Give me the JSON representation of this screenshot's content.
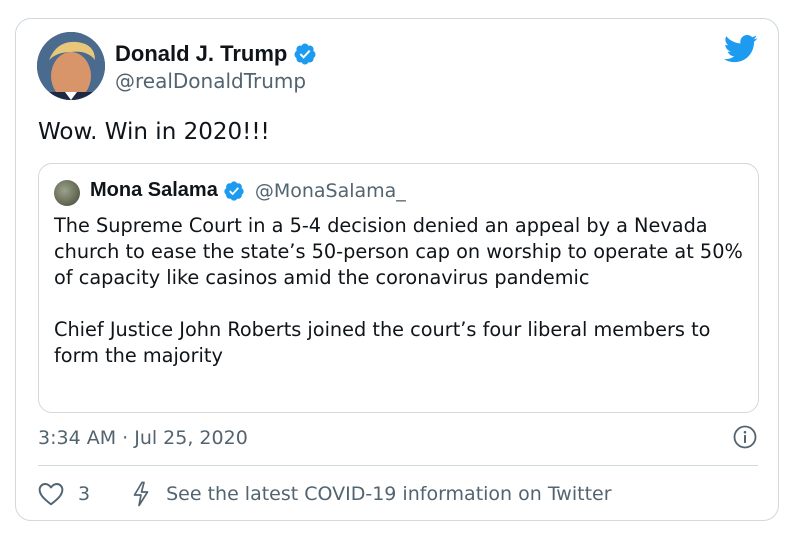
{
  "tweet": {
    "author_name": "Donald J. Trump",
    "author_handle": "@realDonaldTrump",
    "text": "Wow. Win in 2020!!!",
    "timestamp": "3:34 AM · Jul 25, 2020",
    "like_count": "3",
    "covid_info_link": "See the latest COVID-19 information on Twitter"
  },
  "quoted_tweet": {
    "author_name": "Mona Salama",
    "author_handle": "@MonaSalama_",
    "paragraphs": [
      "The Supreme Court in a 5-4 decision denied an appeal by a Nevada church to ease the state’s 50-person cap on worship to operate at 50% of capacity like casinos amid the coronavirus pandemic",
      "Chief Justice John Roberts joined the court’s four liberal members to form the majority"
    ]
  },
  "icons": {
    "brand": "twitter-bird-icon",
    "verified": "verified-badge-icon",
    "info": "info-icon",
    "like": "heart-icon",
    "covid": "flash-icon"
  },
  "colors": {
    "brand_blue": "#1d9bf0",
    "text_primary": "#0f1419",
    "text_secondary": "#536471",
    "border": "#cfd9de"
  }
}
